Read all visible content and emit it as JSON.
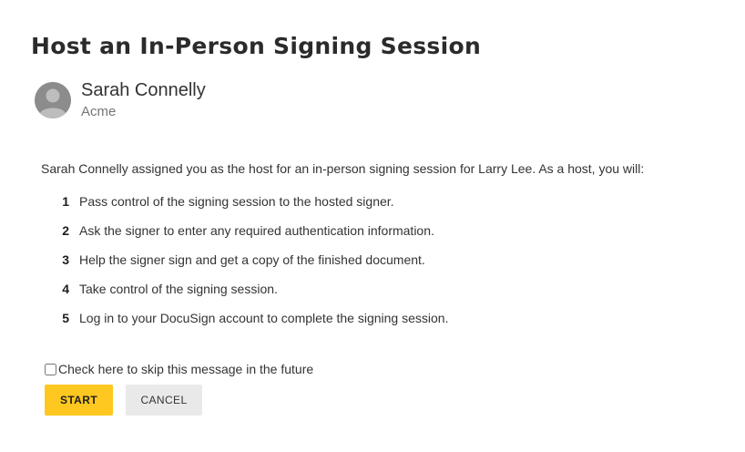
{
  "dialog": {
    "title": "Host an In-Person Signing Session"
  },
  "sender": {
    "name": "Sarah Connelly",
    "company": "Acme",
    "avatar_icon": "user-silhouette-icon"
  },
  "intro": "Sarah Connelly assigned you as the host for an in-person signing session for Larry Lee. As a host, you will:",
  "steps": [
    {
      "number": "1",
      "text": "Pass control of the signing session to the hosted signer."
    },
    {
      "number": "2",
      "text": "Ask the signer to enter any required authentication information."
    },
    {
      "number": "3",
      "text": "Help the signer sign and get a copy of the finished document."
    },
    {
      "number": "4",
      "text": "Take control of the signing session."
    },
    {
      "number": "5",
      "text": "Log in to your DocuSign account to complete the signing session."
    }
  ],
  "skip_checkbox": {
    "label": "Check here to skip this message in the future",
    "checked": false
  },
  "buttons": {
    "start_label": "START",
    "cancel_label": "CANCEL"
  },
  "colors": {
    "start_button": "#ffc820",
    "cancel_button": "#e9e9e9",
    "avatar": "#8c8c8c"
  }
}
